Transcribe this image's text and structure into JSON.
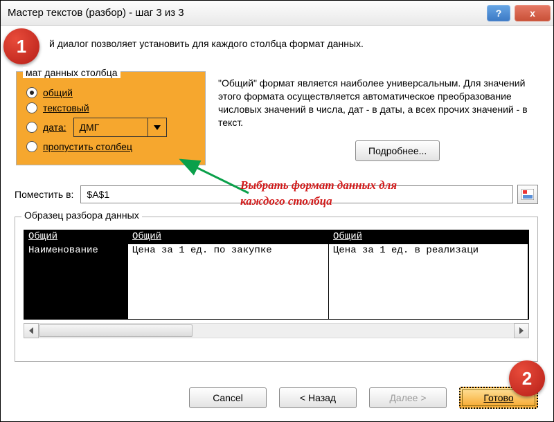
{
  "titlebar": {
    "title": "Мастер текстов (разбор) - шаг 3 из 3",
    "help": "?",
    "close": "x"
  },
  "description": "й диалог позволяет установить для каждого столбца формат данных.",
  "format_group": {
    "legend": "мат данных столбца",
    "radios": {
      "general": "общий",
      "text": "текстовый",
      "date_label": "дата:",
      "date_value": "ДМГ",
      "skip": "пропустить столбец"
    }
  },
  "info_text": "\"Общий\" формат является наиболее универсальным. Для значений этого формата осуществляется автоматическое преобразование числовых значений в числа, дат - в даты, а всех прочих значений - в текст.",
  "details_button": "Подробнее...",
  "place": {
    "label": "Поместить в:",
    "value": "$A$1"
  },
  "annotation": {
    "line1": "Выбрать формат данных для",
    "line2": "каждого столбца"
  },
  "preview": {
    "legend": "Образец разбора данных",
    "headers": [
      "Общий",
      "Общий",
      "Общий"
    ],
    "row": [
      "Наименование",
      "Цена за 1 ед. по закупке",
      "Цена за 1 ед. в реализаци"
    ]
  },
  "buttons": {
    "cancel": "Cancel",
    "back": "< Назад",
    "next": "Далее >",
    "finish": "Готово"
  },
  "markers": {
    "m1": "1",
    "m2": "2"
  }
}
